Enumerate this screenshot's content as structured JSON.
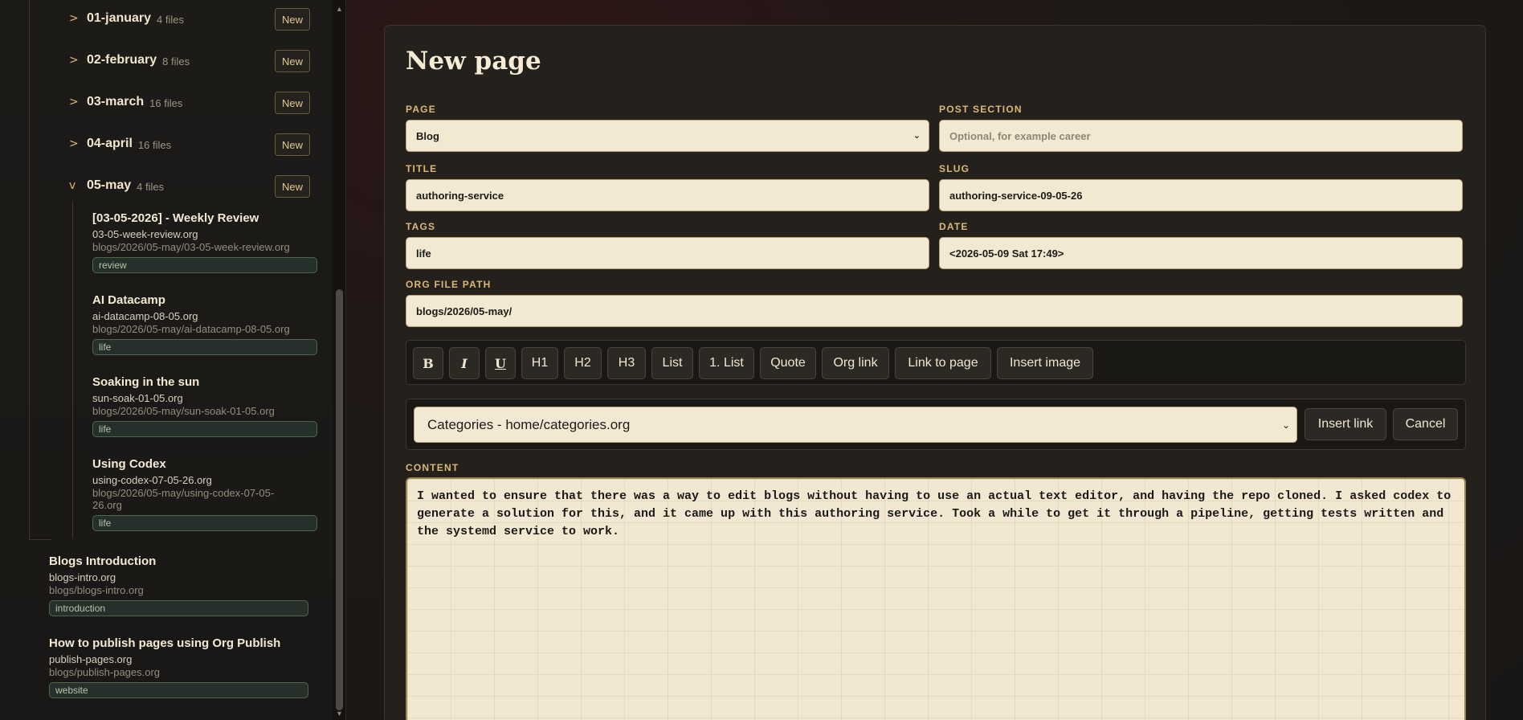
{
  "sidebar": {
    "months": [
      {
        "caret": ">",
        "name": "01-january",
        "count": "4 files",
        "new_label": "New"
      },
      {
        "caret": ">",
        "name": "02-february",
        "count": "8 files",
        "new_label": "New"
      },
      {
        "caret": ">",
        "name": "03-march",
        "count": "16 files",
        "new_label": "New"
      },
      {
        "caret": ">",
        "name": "04-april",
        "count": "16 files",
        "new_label": "New"
      },
      {
        "caret": "v",
        "name": "05-may",
        "count": "4 files",
        "new_label": "New"
      }
    ],
    "may_entries": [
      {
        "title": "[03-05-2026] - Weekly Review",
        "file": "03-05-week-review.org",
        "path": "blogs/2026/05-may/03-05-week-review.org",
        "tag": "review"
      },
      {
        "title": "AI Datacamp",
        "file": "ai-datacamp-08-05.org",
        "path": "blogs/2026/05-may/ai-datacamp-08-05.org",
        "tag": "life"
      },
      {
        "title": "Soaking in the sun",
        "file": "sun-soak-01-05.org",
        "path": "blogs/2026/05-may/sun-soak-01-05.org",
        "tag": "life"
      },
      {
        "title": "Using Codex",
        "file": "using-codex-07-05-26.org",
        "path": "blogs/2026/05-may/using-codex-07-05-26.org",
        "tag": "life"
      }
    ],
    "root_entries": [
      {
        "title": "Blogs Introduction",
        "file": "blogs-intro.org",
        "path": "blogs/blogs-intro.org",
        "tag": "introduction"
      },
      {
        "title": "How to publish pages using Org Publish",
        "file": "publish-pages.org",
        "path": "blogs/publish-pages.org",
        "tag": "website"
      }
    ]
  },
  "form": {
    "title": "New page",
    "page_label": "PAGE",
    "page_value": "Blog",
    "post_section_label": "POST SECTION",
    "post_section_placeholder": "Optional, for example career",
    "title_label": "TITLE",
    "title_value": "authoring-service",
    "slug_label": "SLUG",
    "slug_value": "authoring-service-09-05-26",
    "tags_label": "TAGS",
    "tags_value": "life",
    "date_label": "DATE",
    "date_value": "<2026-05-09 Sat 17:49>",
    "org_path_label": "ORG FILE PATH",
    "org_path_value": "blogs/2026/05-may/"
  },
  "toolbar": {
    "bold": "B",
    "italic": "I",
    "underline": "U",
    "h1": "H1",
    "h2": "H2",
    "h3": "H3",
    "list": "List",
    "ordered_list": "1. List",
    "quote": "Quote",
    "org_link": "Org link",
    "link_to_page": "Link to page",
    "insert_image": "Insert image"
  },
  "linkbar": {
    "selected": "Categories - home/categories.org",
    "insert_label": "Insert link",
    "cancel_label": "Cancel"
  },
  "content": {
    "label": "CONTENT",
    "text": "I wanted to ensure that there was a way to edit blogs without having to use an actual text editor, and having the repo cloned. I asked codex to generate a solution for this, and it came up with this authoring service. Took a while to get it through a pipeline, getting tests written and the systemd service to work."
  },
  "colors": {
    "accent": "#d9b877",
    "input_bg": "#f3e8d1",
    "panel_bg": "#24211c",
    "tag_bg": "#25302a"
  }
}
